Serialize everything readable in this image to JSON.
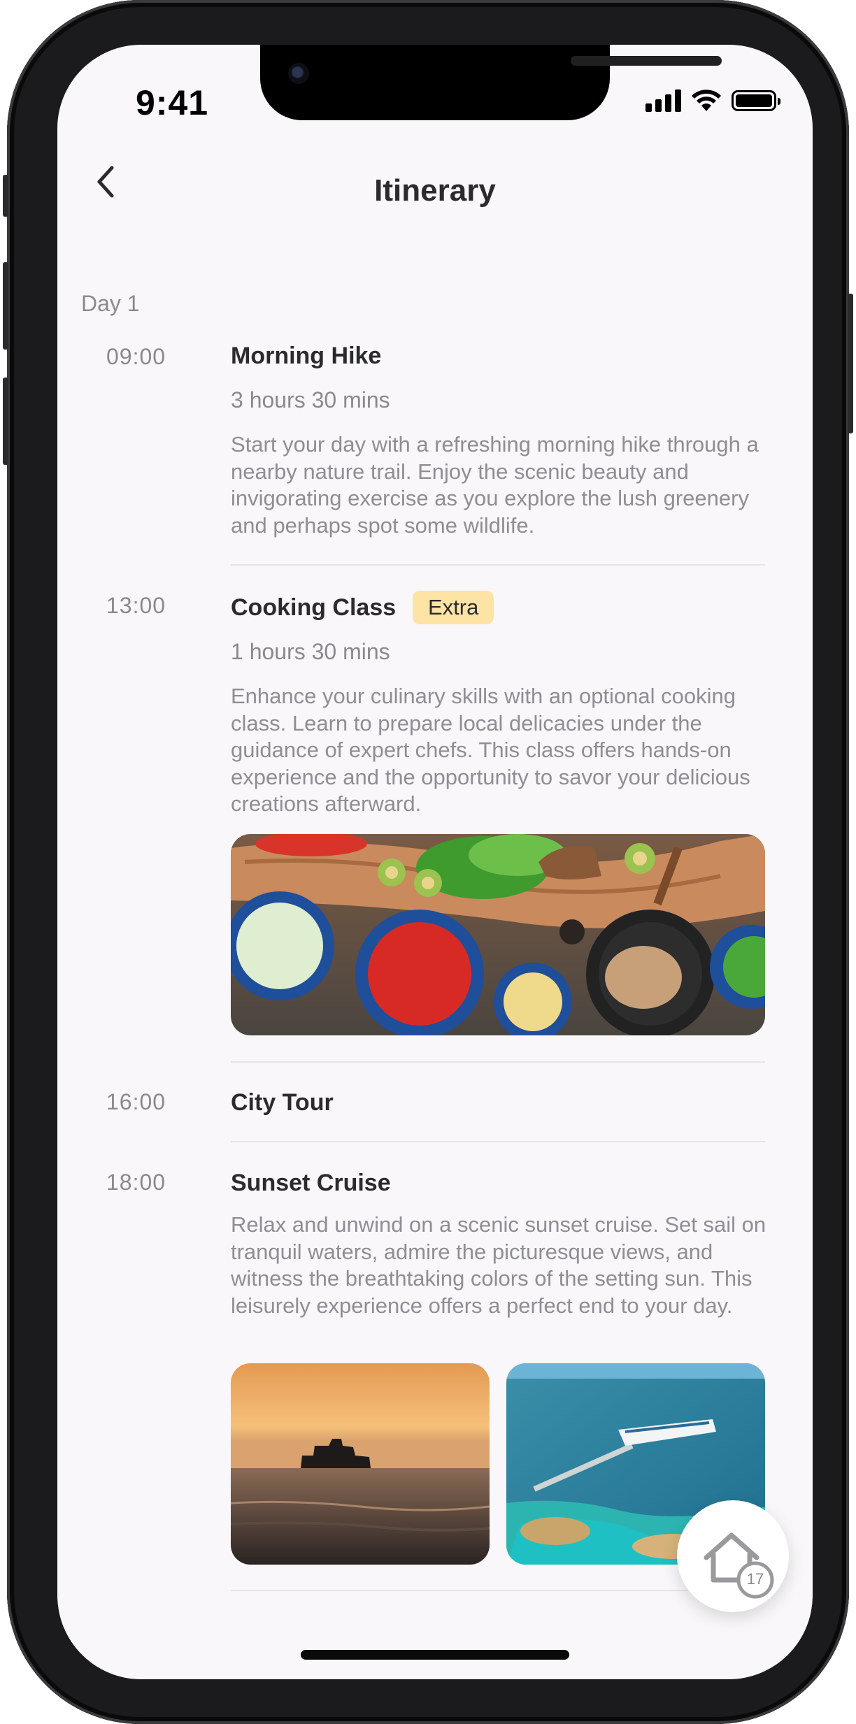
{
  "status_bar": {
    "time": "9:41"
  },
  "header": {
    "title": "Itinerary",
    "back_icon": "chevron-left-icon"
  },
  "days": [
    {
      "label": "Day 1",
      "activities": [
        {
          "time": "09:00",
          "title": "Morning Hike",
          "duration": "3 hours 30 mins",
          "description": "Start your day with a refreshing morning hike through a nearby nature trail. Enjoy the scenic beauty and invigorating exercise as you explore the lush greenery and perhaps spot some wildlife."
        },
        {
          "time": "13:00",
          "title": "Cooking Class",
          "badge": "Extra",
          "duration": "1 hours 30 mins",
          "description": "Enhance your culinary skills with an optional cooking class. Learn to prepare local delicacies under the guidance of expert chefs. This class offers hands-on experience and the opportunity to savor your delicious creations afterward."
        },
        {
          "time": "16:00",
          "title": "City Tour"
        },
        {
          "time": "18:00",
          "title": "Sunset Cruise",
          "description": "Relax and unwind on a scenic sunset cruise. Set sail on tranquil waters, admire the picturesque views, and witness the breathtaking colors of the setting sun. This leisurely experience offers a perfect end to your day."
        }
      ]
    }
  ],
  "floating_button": {
    "icon": "home-icon",
    "count": "17"
  },
  "colors": {
    "background": "#f9f7fa",
    "badge": "#fde4a4",
    "title": "#2b2b2e",
    "muted": "#8a8a8e"
  }
}
